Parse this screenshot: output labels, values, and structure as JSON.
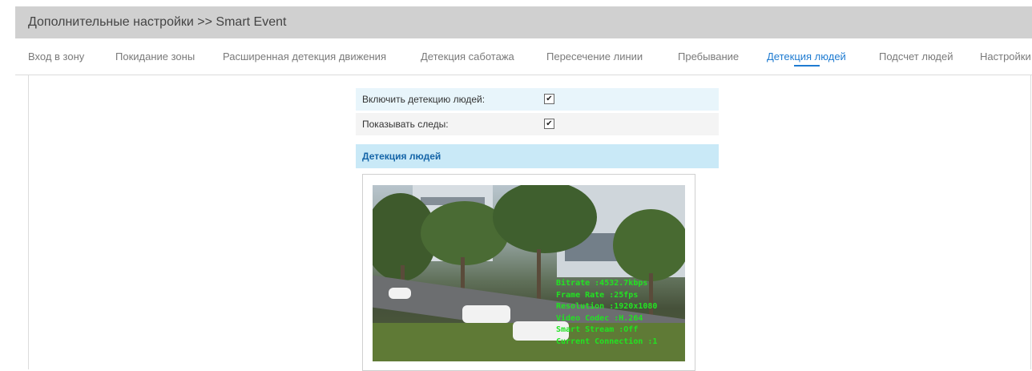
{
  "header": {
    "title": "Дополнительные настройки >> Smart Event"
  },
  "tabs": [
    {
      "label": "Вход в зону",
      "active": false
    },
    {
      "label": "Покидание зоны",
      "active": false
    },
    {
      "label": "Расширенная детекция движения",
      "active": false
    },
    {
      "label": "Детекция саботажа",
      "active": false
    },
    {
      "label": "Пересечение линии",
      "active": false
    },
    {
      "label": "Пребывание",
      "active": false
    },
    {
      "label": "Детекция людей",
      "active": true
    },
    {
      "label": "Подсчет людей",
      "active": false
    },
    {
      "label": "Настройки",
      "active": false
    }
  ],
  "settings": {
    "enable_label": "Включить детекцию людей:",
    "enable_checked": true,
    "show_trails_label": "Показывать следы:",
    "show_trails_checked": true
  },
  "section": {
    "title": "Детекция людей"
  },
  "video": {
    "osd": [
      "Bitrate :4532.7kbps",
      "Frame Rate :25fps",
      "Resolution :1920x1080",
      "Video Codec :H.264",
      "Smart Stream :Off",
      "Current Connection :1"
    ]
  },
  "colors": {
    "accent": "#1e7bd1",
    "row_highlight": "#e8f5fb",
    "section_bg": "#c9e9f7",
    "osd_text": "#22e322"
  }
}
